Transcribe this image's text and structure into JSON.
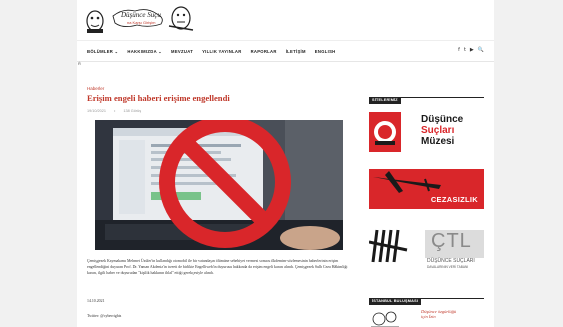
{
  "site": {
    "logo_text": "Düşünce Suçu(!?) na Karşı Girişim"
  },
  "nav": {
    "items": [
      "BÖLÜMLER ⌄",
      "HAKKIMIZDA ⌄",
      "MEVZUAT",
      "YILLIK YAYINLAR",
      "RAPORLAR",
      "İLETİŞİM",
      "ENGLISH"
    ],
    "social": [
      "f",
      "t",
      "▶",
      "🔍"
    ]
  },
  "stray_char": "Ŕ",
  "article": {
    "category": "Haberler",
    "title": "Erişim engeli haberi erişime engellendi",
    "date": "19/10/2021",
    "views": "138 Görüş",
    "paragraph1": "Çemişgezek Kaymakamı Mehmet Üzüler'in kullandığı otomobil ile bir vatandaşın ölümüne sebebiyet vermesi sonucu ilkdemim-sözlemesinin haberlerinin erişim engellendiğini duyuran Prof. Dr. Yaman Akdeniz'in tweeti de birlikte Engelliweb'in duyurusu hakkında da erişim engeli kararı alındı. Çemişgezek Sulh Ceza Hâkimliği kararı, ilgili haber ve duyurudan \"kişilik hakkının ihlal\" ettiği gerekçesiyle alındı.",
    "paragraph2": "14.10.2021",
    "paragraph3": "Twitter: @cyberrights"
  },
  "sidebar": {
    "section1_title": "SİTELERİMİZ",
    "museum": {
      "line1": "Düşünce",
      "line2": "Suçları",
      "line3": "Müzesi"
    },
    "cezasizlik": "CEZASIZLIK",
    "ctl": {
      "big": "ÇTL",
      "sub1": "DÜŞÜNCE SUÇLARI",
      "sub2": "DAVALARININ VERİ TABANI"
    },
    "section2_title": "İSTANBUL BULUŞMASI",
    "istanbul_tag": "Düşünce özgürlüğü için İzin"
  },
  "colors": {
    "accent": "#c0392b",
    "prohibit_red": "#d9262a",
    "dark": "#222222"
  }
}
